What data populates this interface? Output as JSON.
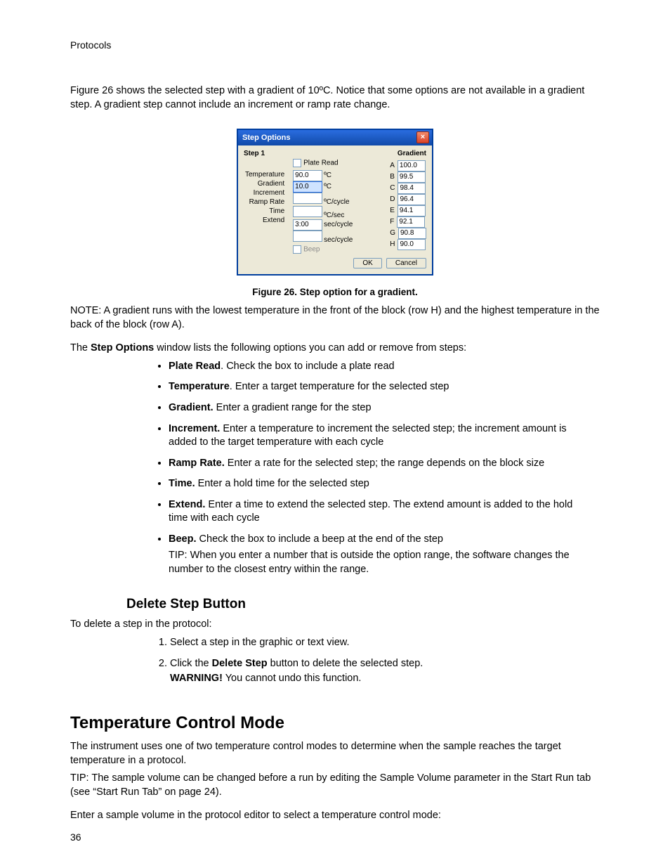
{
  "running_head": "Protocols",
  "intro_para": "Figure 26 shows the selected step with a gradient of 10ºC. Notice that some options are not available in a gradient step. A gradient step cannot include an increment or ramp rate change.",
  "dialog": {
    "title": "Step Options",
    "step_label": "Step 1",
    "gradient_label": "Gradient",
    "plate_read": "Plate Read",
    "rows": {
      "temperature": {
        "label": "Temperature",
        "value": "90.0",
        "unit": "ºC"
      },
      "gradient": {
        "label": "Gradient",
        "value": "10.0",
        "unit": "ºC"
      },
      "increment": {
        "label": "Increment",
        "value": "",
        "unit": "ºC/cycle"
      },
      "ramp": {
        "label": "Ramp Rate",
        "value": "",
        "unit": "ºC/sec"
      },
      "time": {
        "label": "Time",
        "value": "3:00",
        "unit": "sec/cycle"
      },
      "extend": {
        "label": "Extend",
        "value": "",
        "unit": "sec/cycle"
      }
    },
    "beep": "Beep",
    "gradient_table": [
      {
        "row": "A",
        "val": "100.0"
      },
      {
        "row": "B",
        "val": "99.5"
      },
      {
        "row": "C",
        "val": "98.4"
      },
      {
        "row": "D",
        "val": "96.4"
      },
      {
        "row": "E",
        "val": "94.1"
      },
      {
        "row": "F",
        "val": "92.1"
      },
      {
        "row": "G",
        "val": "90.8"
      },
      {
        "row": "H",
        "val": "90.0"
      }
    ],
    "ok": "OK",
    "cancel": "Cancel"
  },
  "caption": "Figure 26. Step option for a gradient.",
  "note": "NOTE: A gradient runs with the lowest temperature in the front of the block (row H) and the highest temperature in the back of the block (row A).",
  "options_intro_a": "The ",
  "options_intro_b": "Step Options",
  "options_intro_c": " window lists the following options you can add or remove from steps:",
  "opts": [
    {
      "b": "Plate Read",
      "t": ". Check the box to include a plate read"
    },
    {
      "b": "Temperature",
      "t": ". Enter a target temperature for the selected step"
    },
    {
      "b": "Gradient.",
      "t": " Enter a gradient range for the step"
    },
    {
      "b": "Increment.",
      "t": " Enter a temperature to increment the selected step; the increment amount is added to the target temperature with each cycle"
    },
    {
      "b": "Ramp Rate.",
      "t": " Enter a rate for the selected step; the range depends on the block size"
    },
    {
      "b": "Time.",
      "t": " Enter a hold time for the selected step"
    },
    {
      "b": "Extend.",
      "t": " Enter a time to extend the selected step. The extend amount is added to the hold time with each cycle"
    },
    {
      "b": "Beep.",
      "t": " Check the box to include a beep at the end of the step"
    }
  ],
  "tip1": "TIP: When you enter a number that is outside the option range, the software changes the number to the closest entry within the range.",
  "delete_h": "Delete Step Button",
  "delete_intro": "To delete a step in the protocol:",
  "delete_steps": [
    "Select a step in the graphic or text view.",
    ""
  ],
  "delete_step2_a": "Click the ",
  "delete_step2_b": "Delete Step",
  "delete_step2_c": " button to delete the selected step.",
  "delete_warn_b": "WARNING!",
  "delete_warn_t": " You cannot undo this function.",
  "tcm_h": "Temperature Control Mode",
  "tcm_p1": "The instrument uses one of two temperature control modes to determine when the sample reaches the target temperature in a protocol.",
  "tcm_tip": "TIP: The sample volume can be changed before a run by editing the Sample Volume parameter in the Start Run tab (see “Start Run Tab” on page 24).",
  "tcm_p2": "Enter a sample volume in the protocol editor to select a temperature control mode:",
  "page_num": "36"
}
